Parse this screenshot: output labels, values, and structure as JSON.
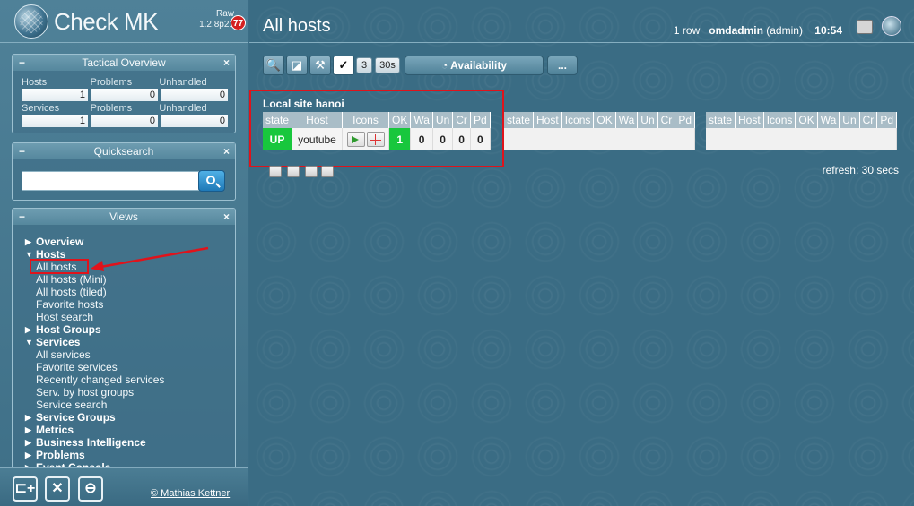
{
  "sidebar": {
    "logo_text": "Check MK",
    "edition_line1": "Raw",
    "edition_line2": "1.2.8p21",
    "edition_badge": "77",
    "tactical": {
      "title": "Tactical Overview",
      "labels_hosts": [
        "Hosts",
        "Problems",
        "Unhandled"
      ],
      "values_hosts": [
        "1",
        "0",
        "0"
      ],
      "labels_services": [
        "Services",
        "Problems",
        "Unhandled"
      ],
      "values_services": [
        "1",
        "0",
        "0"
      ]
    },
    "quicksearch": {
      "title": "Quicksearch",
      "value": ""
    },
    "views": {
      "title": "Views",
      "overview": "Overview",
      "hosts": "Hosts",
      "host_items": [
        "All hosts",
        "All hosts (Mini)",
        "All hosts (tiled)",
        "Favorite hosts",
        "Host search"
      ],
      "host_groups": "Host Groups",
      "services": "Services",
      "service_items": [
        "All services",
        "Favorite services",
        "Recently changed services",
        "Serv. by host groups",
        "Service search"
      ],
      "service_groups": "Service Groups",
      "metrics": "Metrics",
      "bi": "Business Intelligence",
      "problems": "Problems",
      "event_console": "Event Console"
    },
    "copyright": "© Mathias Kettner",
    "icons": [
      "add-snapin-icon",
      "tools-icon",
      "logout-icon"
    ]
  },
  "header": {
    "title": "All hosts",
    "rows": "1 row",
    "user": "omdadmin",
    "role": "(admin)",
    "time": "10:54"
  },
  "toolbar": {
    "refresh_count": "3",
    "refresh_interval": "30s",
    "availability": "Availability",
    "more": "..."
  },
  "site": {
    "name": "Local site hanoi",
    "columns": [
      "state",
      "Host",
      "Icons",
      "OK",
      "Wa",
      "Un",
      "Cr",
      "Pd"
    ],
    "row": {
      "state": "UP",
      "host": "youtube",
      "ok": "1",
      "wa": "0",
      "un": "0",
      "cr": "0",
      "pd": "0"
    }
  },
  "refresh_text": "refresh: 30 secs",
  "colors": {
    "up": "#18c73d",
    "highlight": "#e0131b",
    "header_bg": "#a9bdc7"
  }
}
